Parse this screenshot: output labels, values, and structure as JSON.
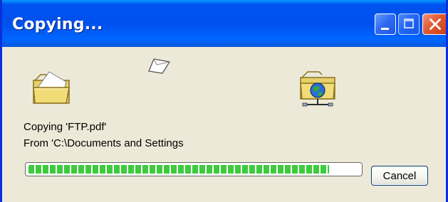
{
  "window": {
    "title": "Copying..."
  },
  "titlebar_buttons": {
    "minimize": "minimize-icon",
    "maximize": "maximize-icon",
    "close": "close-icon"
  },
  "animation": {
    "source_icon": "folder-icon",
    "moving_icon": "flying-document-icon",
    "destination_icon": "network-folder-icon"
  },
  "status": {
    "line1": "Copying 'FTP.pdf'",
    "line2": "From 'C:\\Documents and Settings"
  },
  "progress": {
    "value": 0.91
  },
  "actions": {
    "cancel_label": "Cancel"
  },
  "colors": {
    "titlebar": "#0053ee",
    "window_bg": "#ece9d8",
    "progress_fill": "#3ccb3c",
    "close_button": "#e2592f"
  }
}
